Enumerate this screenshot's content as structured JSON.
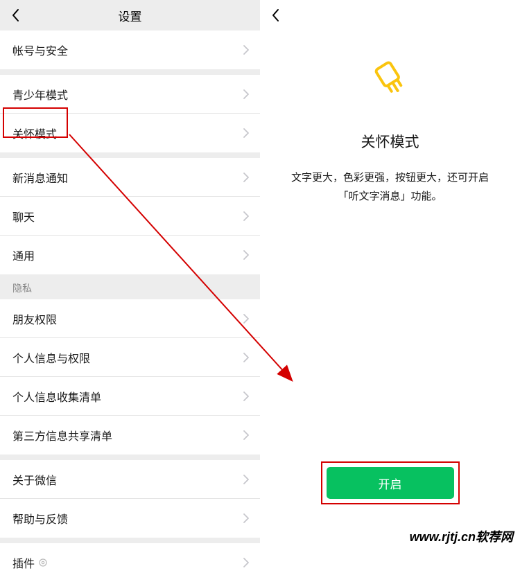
{
  "left": {
    "title": "设置",
    "rows": {
      "account_security": "帐号与安全",
      "teen_mode": "青少年模式",
      "care_mode": "关怀模式",
      "new_msg_notify": "新消息通知",
      "chat": "聊天",
      "general": "通用",
      "privacy_section": "隐私",
      "friend_permission": "朋友权限",
      "personal_info_permission": "个人信息与权限",
      "personal_info_collection": "个人信息收集清单",
      "third_party_sharing": "第三方信息共享清单",
      "about_wechat": "关于微信",
      "help_feedback": "帮助与反馈",
      "plugins": "插件"
    }
  },
  "right": {
    "title": "关怀模式",
    "desc_line1": "文字更大，色彩更强，按钮更大，还可开启",
    "desc_line2": "「听文字消息」功能。",
    "enable_button": "开启"
  },
  "watermark": "www.rjtj.cn软荐网",
  "colors": {
    "highlight_border": "#d40000",
    "primary_button": "#07c160",
    "icon_accent": "#fac40e"
  }
}
